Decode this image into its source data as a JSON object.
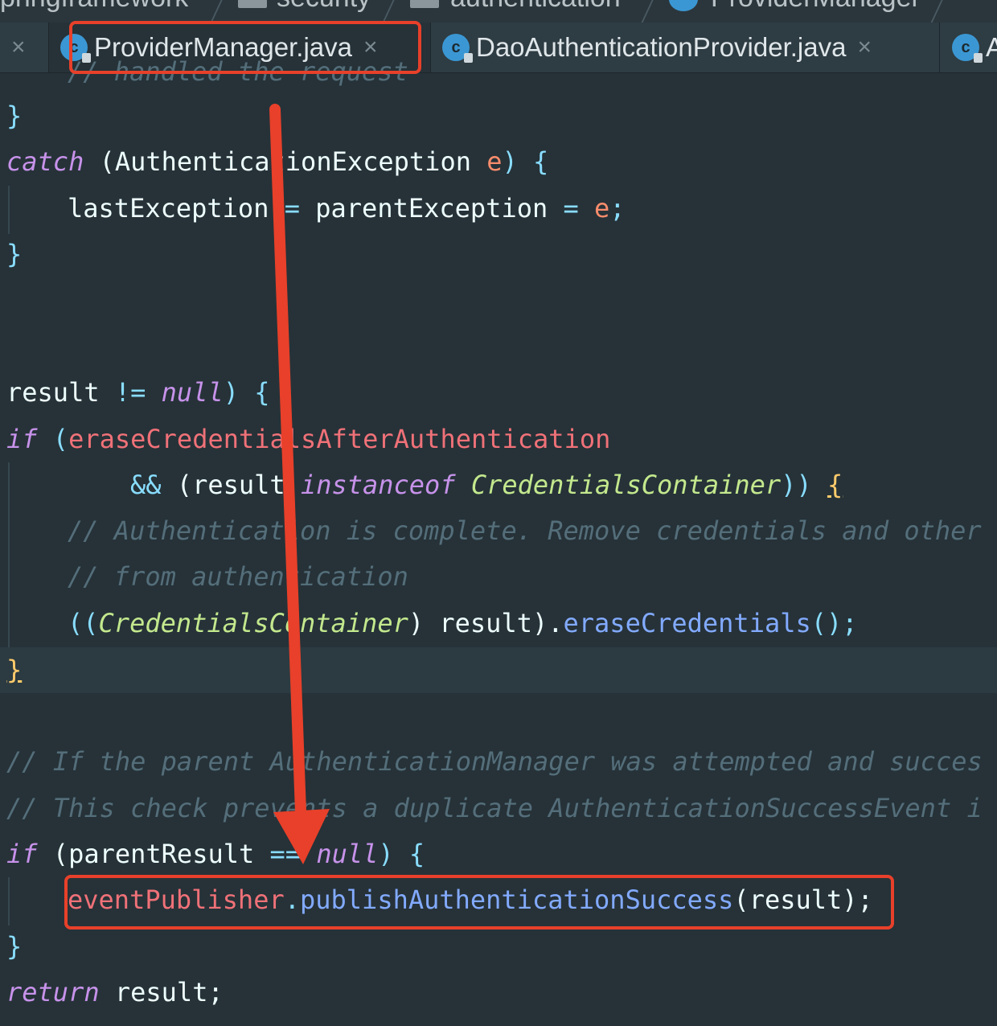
{
  "breadcrumb": {
    "items": [
      "pringframework",
      "security",
      "authentication",
      "ProviderManager"
    ]
  },
  "tabs": [
    {
      "label": "ProviderManager.java",
      "active": true,
      "icon": "java-class-icon"
    },
    {
      "label": "DaoAuthenticationProvider.java",
      "active": false,
      "icon": "java-class-icon"
    },
    {
      "label": "A",
      "active": false,
      "icon": "java-class-icon"
    }
  ],
  "tab_close_glyph": "×",
  "code": {
    "lines": {
      "l0": "// handled the request",
      "l1": "}",
      "l2a": "catch",
      "l2b": " (AuthenticationException ",
      "l2c": "e",
      "l2d": ") {",
      "l3a": "lastException",
      "l3b": " = ",
      "l3c": "parentException",
      "l3d": " = ",
      "l3e": "e",
      "l3f": ";",
      "l4": "}",
      "l5a": "result ",
      "l5b": "!=",
      "l5c": " null",
      "l5d": ") {",
      "l6a": "if",
      "l6b": " (",
      "l6c": "eraseCredentialsAfterAuthentication",
      "l7a": "&&",
      "l7b": " (result ",
      "l7c": "instanceof",
      "l7d": " CredentialsContainer",
      "l7e": ")) ",
      "l7f": "{",
      "l8": "// Authentication is complete. Remove credentials and other",
      "l9": "// from authentication",
      "l10a": "((",
      "l10b": "CredentialsContainer",
      "l10c": ") result).",
      "l10d": "eraseCredentials",
      "l10e": "();",
      "l11": "}",
      "l12": "// If the parent AuthenticationManager was attempted and succes",
      "l13": "// This check prevents a duplicate AuthenticationSuccessEvent i",
      "l14a": "if",
      "l14b": " (parentResult ",
      "l14c": "==",
      "l14d": " null",
      "l14e": ") {",
      "l15a": "eventPublisher",
      "l15b": ".",
      "l15c": "publishAuthenticationSuccess",
      "l15d": "(result);",
      "l16": "}",
      "l17a": "return",
      "l17b": " result;"
    }
  },
  "colors": {
    "background": "#263238",
    "annotation": "#e8402a",
    "keyword": "#c792ea",
    "field": "#f07178",
    "function": "#82aaff",
    "comment": "#546e7a",
    "type": "#c3e88d"
  }
}
